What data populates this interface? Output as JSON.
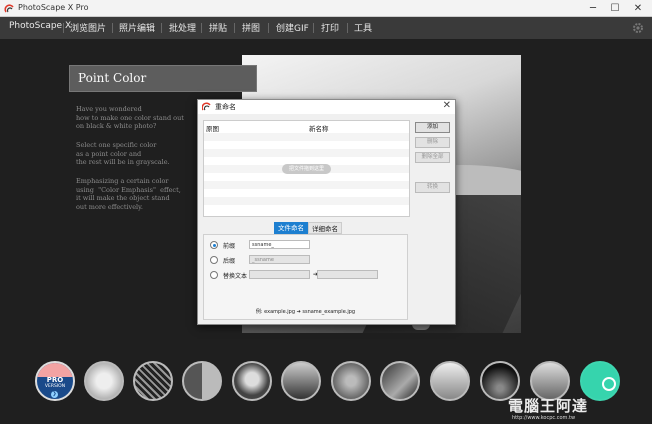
{
  "window": {
    "title": "PhotoScape X Pro",
    "minimize": "─",
    "maximize": "☐",
    "close": "✕"
  },
  "menu": [
    "PhotoScape X",
    "浏览图片",
    "照片编辑",
    "批处理",
    "拼贴",
    "拼图",
    "创建GIF",
    "打印",
    "工具"
  ],
  "feature": {
    "title": "Point Color",
    "desc1": "Have you wondered\nhow to make one color stand out\non black & white photo?",
    "desc2": "Select one specific color\nas a point color and\nthe rest will be in grayscale.",
    "desc3": "Emphasizing a certain color\nusing  \"Color Emphasis\"  effect,\nit will make the object stand\nout more effectively."
  },
  "dialog": {
    "title": "重命名",
    "col_original": "原图",
    "col_new": "新名称",
    "drop_hint": "把文件拖到这里",
    "buttons": {
      "add": "添加",
      "delete": "删除",
      "delete_all": "删除全部",
      "convert": "转换"
    },
    "tabs": {
      "filename": "文件命名",
      "detail": "详细命名"
    },
    "options": {
      "prefix_label": "前缀",
      "prefix_value": "ssname_",
      "suffix_label": "后缀",
      "suffix_value": "_ssname",
      "replace_label": "替换文本",
      "replace_arrow": "➔"
    },
    "example": "例: example.jpg ➔ ssname_example.jpg"
  },
  "thumbs": {
    "pro_line1": "PRO",
    "pro_line2": "VERSION",
    "pro_arrow": "❯"
  },
  "watermark": {
    "brand": "電腦王阿達",
    "url": "http://www.kocpc.com.tw"
  },
  "colors": {
    "accent": "#1d7fd0",
    "menubar": "#3a3a3a",
    "background": "#1f1f1f"
  }
}
